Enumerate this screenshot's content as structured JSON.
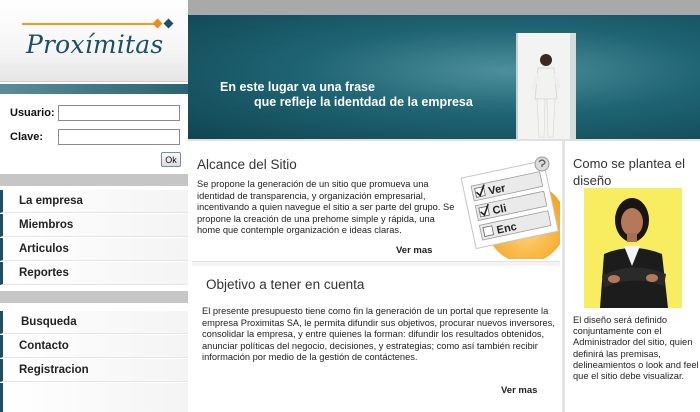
{
  "logo": {
    "text": "Proxímitas"
  },
  "login": {
    "user_label": "Usuario:",
    "pass_label": "Clave:",
    "user_value": "",
    "pass_value": "",
    "ok_label": "Ok"
  },
  "nav": {
    "group1": [
      "La empresa",
      "Miembros",
      "Articulos",
      "Reportes"
    ],
    "group2": [
      "Busqueda",
      "Contacto",
      "Registracion"
    ]
  },
  "banner": {
    "line1": "En este lugar va una frase",
    "line2": "que refleje  la identdad de la empresa"
  },
  "alcance": {
    "title": "Alcance del Sitio",
    "text": "Se propone la generación de un sitio que promueva una identidad de transparencia, y organización empresarial, incentivando a quien navegue el sitio a ser parte del grupo. Se propone la creación de una prehome simple y rápida, una home que contemple organización e ideas claras.",
    "more": "Ver mas",
    "checklist_words": [
      "Ver",
      "Cli",
      "Enc"
    ]
  },
  "objetivo": {
    "title": "Objetivo a tener en cuenta",
    "text": "El presente presupuesto tiene como fin la generación de un portal que represente la empresa Proximitas SA, le permita difundir sus objetivos, procurar nuevos inversores, consolidar la empresa, y entre quienes la forman: difundir los resultados obtenidos, anunciar políticas del negocio, decisiones,  y estrategias; como así también recibir información por medio de la gestión de contáctenes.",
    "more": "Ver mas"
  },
  "plantea": {
    "title": "Como se plantea el diseño",
    "text": "El diseño será definido conjuntamente con el Administrador del sitio, quien definirá las premisas, delineamientos o look and feel que el sitio debe visualizar."
  },
  "colors": {
    "brand_teal": "#1d4f66",
    "accent_orange": "#f39a1a",
    "banner_dark": "#0f4552",
    "photo_yellow": "#f5e93e"
  }
}
